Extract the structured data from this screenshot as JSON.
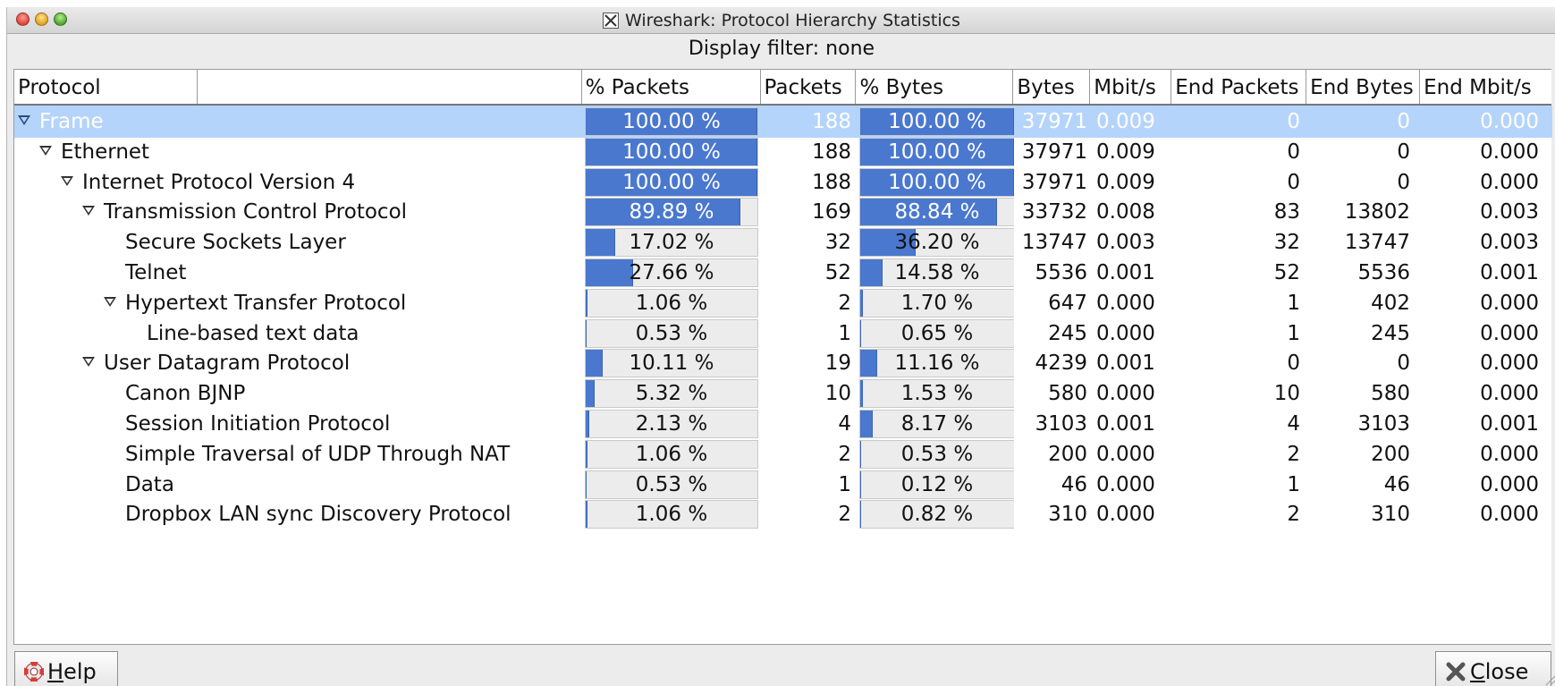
{
  "window": {
    "title": "Wireshark: Protocol Hierarchy Statistics",
    "display_filter": "Display filter: none"
  },
  "columns": [
    "Protocol",
    "% Packets",
    "Packets",
    "% Bytes",
    "Bytes",
    "Mbit/s",
    "End Packets",
    "End Bytes",
    "End Mbit/s"
  ],
  "rows": [
    {
      "protocol": "Frame",
      "indent": 0,
      "expander": true,
      "selected": true,
      "pct_packets": "100.00 %",
      "pct_packets_value": 100.0,
      "packets": "188",
      "pct_bytes": "100.00 %",
      "pct_bytes_value": 100.0,
      "bytes": "37971",
      "mbits": "0.009",
      "end_packets": "0",
      "end_bytes": "0",
      "end_mbits": "0.000"
    },
    {
      "protocol": "Ethernet",
      "indent": 1,
      "expander": true,
      "selected": false,
      "pct_packets": "100.00 %",
      "pct_packets_value": 100.0,
      "packets": "188",
      "pct_bytes": "100.00 %",
      "pct_bytes_value": 100.0,
      "bytes": "37971",
      "mbits": "0.009",
      "end_packets": "0",
      "end_bytes": "0",
      "end_mbits": "0.000"
    },
    {
      "protocol": "Internet Protocol Version 4",
      "indent": 2,
      "expander": true,
      "selected": false,
      "pct_packets": "100.00 %",
      "pct_packets_value": 100.0,
      "packets": "188",
      "pct_bytes": "100.00 %",
      "pct_bytes_value": 100.0,
      "bytes": "37971",
      "mbits": "0.009",
      "end_packets": "0",
      "end_bytes": "0",
      "end_mbits": "0.000"
    },
    {
      "protocol": "Transmission Control Protocol",
      "indent": 3,
      "expander": true,
      "selected": false,
      "pct_packets": "89.89 %",
      "pct_packets_value": 89.89,
      "packets": "169",
      "pct_bytes": "88.84 %",
      "pct_bytes_value": 88.84,
      "bytes": "33732",
      "mbits": "0.008",
      "end_packets": "83",
      "end_bytes": "13802",
      "end_mbits": "0.003"
    },
    {
      "protocol": "Secure Sockets Layer",
      "indent": 4,
      "expander": false,
      "selected": false,
      "pct_packets": "17.02 %",
      "pct_packets_value": 17.02,
      "packets": "32",
      "pct_bytes": "36.20 %",
      "pct_bytes_value": 36.2,
      "bytes": "13747",
      "mbits": "0.003",
      "end_packets": "32",
      "end_bytes": "13747",
      "end_mbits": "0.003"
    },
    {
      "protocol": "Telnet",
      "indent": 4,
      "expander": false,
      "selected": false,
      "pct_packets": "27.66 %",
      "pct_packets_value": 27.66,
      "packets": "52",
      "pct_bytes": "14.58 %",
      "pct_bytes_value": 14.58,
      "bytes": "5536",
      "mbits": "0.001",
      "end_packets": "52",
      "end_bytes": "5536",
      "end_mbits": "0.001"
    },
    {
      "protocol": "Hypertext Transfer Protocol",
      "indent": 4,
      "expander": true,
      "selected": false,
      "pct_packets": "1.06 %",
      "pct_packets_value": 1.06,
      "packets": "2",
      "pct_bytes": "1.70 %",
      "pct_bytes_value": 1.7,
      "bytes": "647",
      "mbits": "0.000",
      "end_packets": "1",
      "end_bytes": "402",
      "end_mbits": "0.000"
    },
    {
      "protocol": "Line-based text data",
      "indent": 5,
      "expander": false,
      "selected": false,
      "pct_packets": "0.53 %",
      "pct_packets_value": 0.53,
      "packets": "1",
      "pct_bytes": "0.65 %",
      "pct_bytes_value": 0.65,
      "bytes": "245",
      "mbits": "0.000",
      "end_packets": "1",
      "end_bytes": "245",
      "end_mbits": "0.000"
    },
    {
      "protocol": "User Datagram Protocol",
      "indent": 3,
      "expander": true,
      "selected": false,
      "pct_packets": "10.11 %",
      "pct_packets_value": 10.11,
      "packets": "19",
      "pct_bytes": "11.16 %",
      "pct_bytes_value": 11.16,
      "bytes": "4239",
      "mbits": "0.001",
      "end_packets": "0",
      "end_bytes": "0",
      "end_mbits": "0.000"
    },
    {
      "protocol": "Canon BJNP",
      "indent": 4,
      "expander": false,
      "selected": false,
      "pct_packets": "5.32 %",
      "pct_packets_value": 5.32,
      "packets": "10",
      "pct_bytes": "1.53 %",
      "pct_bytes_value": 1.53,
      "bytes": "580",
      "mbits": "0.000",
      "end_packets": "10",
      "end_bytes": "580",
      "end_mbits": "0.000"
    },
    {
      "protocol": "Session Initiation Protocol",
      "indent": 4,
      "expander": false,
      "selected": false,
      "pct_packets": "2.13 %",
      "pct_packets_value": 2.13,
      "packets": "4",
      "pct_bytes": "8.17 %",
      "pct_bytes_value": 8.17,
      "bytes": "3103",
      "mbits": "0.001",
      "end_packets": "4",
      "end_bytes": "3103",
      "end_mbits": "0.001"
    },
    {
      "protocol": "Simple Traversal of UDP Through NAT",
      "indent": 4,
      "expander": false,
      "selected": false,
      "pct_packets": "1.06 %",
      "pct_packets_value": 1.06,
      "packets": "2",
      "pct_bytes": "0.53 %",
      "pct_bytes_value": 0.53,
      "bytes": "200",
      "mbits": "0.000",
      "end_packets": "2",
      "end_bytes": "200",
      "end_mbits": "0.000"
    },
    {
      "protocol": "Data",
      "indent": 4,
      "expander": false,
      "selected": false,
      "pct_packets": "0.53 %",
      "pct_packets_value": 0.53,
      "packets": "1",
      "pct_bytes": "0.12 %",
      "pct_bytes_value": 0.12,
      "bytes": "46",
      "mbits": "0.000",
      "end_packets": "1",
      "end_bytes": "46",
      "end_mbits": "0.000"
    },
    {
      "protocol": "Dropbox LAN sync Discovery Protocol",
      "indent": 4,
      "expander": false,
      "selected": false,
      "pct_packets": "1.06 %",
      "pct_packets_value": 1.06,
      "packets": "2",
      "pct_bytes": "0.82 %",
      "pct_bytes_value": 0.82,
      "bytes": "310",
      "mbits": "0.000",
      "end_packets": "2",
      "end_bytes": "310",
      "end_mbits": "0.000"
    }
  ],
  "buttons": {
    "help_label": "Help",
    "close_label": "Close"
  },
  "icons": {
    "help": "lifebuoy-icon",
    "close": "x-close-icon",
    "expander": "triangle-down-icon",
    "window": "x11-icon"
  },
  "colors": {
    "bar_fill": "#4a78cf",
    "selection": "#b4d4fb"
  }
}
